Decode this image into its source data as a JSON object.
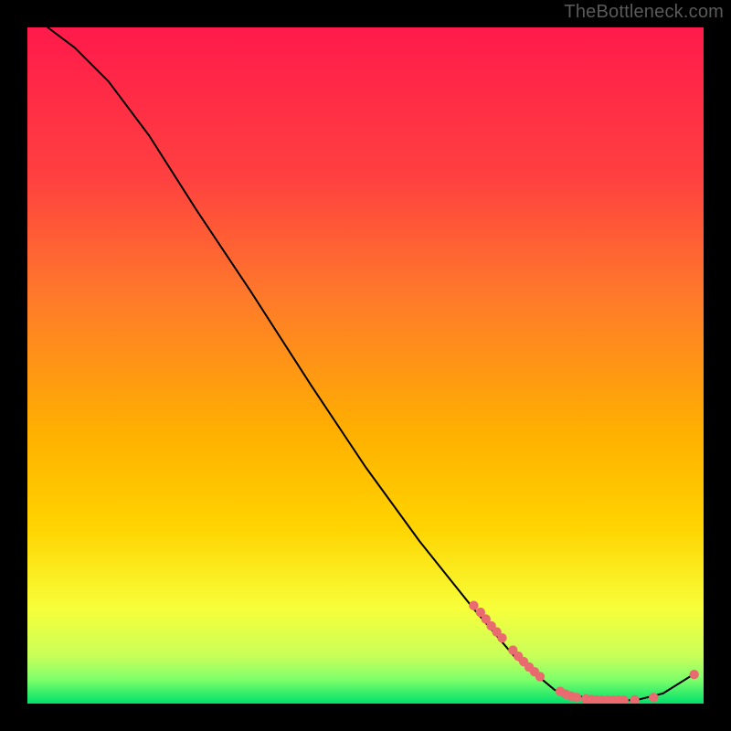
{
  "watermark": "TheBottleneck.com",
  "chart_data": {
    "type": "line",
    "title": "",
    "xlabel": "",
    "ylabel": "",
    "xlim": [
      0,
      100
    ],
    "ylim": [
      0,
      100
    ],
    "background_gradient": {
      "top": "#ff1a4b",
      "upper_mid": "#ff7a2a",
      "mid": "#ffd400",
      "lower_mid": "#f7ff3a",
      "bottom": "#00e06b"
    },
    "curve": [
      {
        "x": 3,
        "y": 100
      },
      {
        "x": 7,
        "y": 97
      },
      {
        "x": 12,
        "y": 92
      },
      {
        "x": 18,
        "y": 84
      },
      {
        "x": 25,
        "y": 73
      },
      {
        "x": 33,
        "y": 61
      },
      {
        "x": 42,
        "y": 47
      },
      {
        "x": 50,
        "y": 35
      },
      {
        "x": 58,
        "y": 24
      },
      {
        "x": 66,
        "y": 14
      },
      {
        "x": 72,
        "y": 7
      },
      {
        "x": 78,
        "y": 2
      },
      {
        "x": 84,
        "y": 0.5
      },
      {
        "x": 90,
        "y": 0.5
      },
      {
        "x": 94,
        "y": 1.5
      },
      {
        "x": 98,
        "y": 4
      }
    ],
    "markers": [
      {
        "x": 66,
        "y": 14.5
      },
      {
        "x": 67,
        "y": 13.5
      },
      {
        "x": 67.8,
        "y": 12.5
      },
      {
        "x": 68.6,
        "y": 11.5
      },
      {
        "x": 69.4,
        "y": 10.6
      },
      {
        "x": 70.2,
        "y": 9.7
      },
      {
        "x": 71.8,
        "y": 7.9
      },
      {
        "x": 72.6,
        "y": 7.0
      },
      {
        "x": 73.4,
        "y": 6.2
      },
      {
        "x": 74.2,
        "y": 5.4
      },
      {
        "x": 75.0,
        "y": 4.7
      },
      {
        "x": 75.8,
        "y": 4.0
      },
      {
        "x": 78.8,
        "y": 1.8
      },
      {
        "x": 79.6,
        "y": 1.4
      },
      {
        "x": 80.4,
        "y": 1.1
      },
      {
        "x": 81.2,
        "y": 0.9
      },
      {
        "x": 82.6,
        "y": 0.7
      },
      {
        "x": 83.4,
        "y": 0.6
      },
      {
        "x": 84.2,
        "y": 0.55
      },
      {
        "x": 85.0,
        "y": 0.5
      },
      {
        "x": 85.8,
        "y": 0.5
      },
      {
        "x": 86.6,
        "y": 0.5
      },
      {
        "x": 87.4,
        "y": 0.5
      },
      {
        "x": 88.2,
        "y": 0.5
      },
      {
        "x": 89.8,
        "y": 0.55
      },
      {
        "x": 92.6,
        "y": 0.9
      },
      {
        "x": 98.6,
        "y": 4.3
      }
    ],
    "marker_color": "#e96a6f",
    "curve_color": "#000000"
  }
}
